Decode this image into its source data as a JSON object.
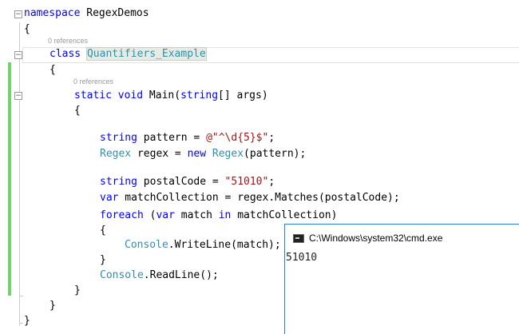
{
  "editor": {
    "refs_label": "0 references",
    "lines": [
      {
        "indent": 0,
        "tokens": [
          {
            "c": "kw",
            "text": "namespace"
          },
          {
            "c": "tx",
            "text": " RegexDemos"
          }
        ]
      },
      {
        "indent": 0,
        "tokens": [
          {
            "c": "tx",
            "text": "{"
          }
        ]
      },
      {
        "indent": 1,
        "tokens": [
          {
            "c": "kw",
            "text": "class"
          },
          {
            "c": "tx",
            "text": " "
          },
          {
            "c": "ty hl",
            "text": "Quantifiers_Example"
          }
        ]
      },
      {
        "indent": 1,
        "tokens": [
          {
            "c": "tx",
            "text": "{"
          }
        ]
      },
      {
        "indent": 2,
        "tokens": [
          {
            "c": "kw",
            "text": "static"
          },
          {
            "c": "tx",
            "text": " "
          },
          {
            "c": "kw",
            "text": "void"
          },
          {
            "c": "tx",
            "text": " Main("
          },
          {
            "c": "kw",
            "text": "string"
          },
          {
            "c": "tx",
            "text": "[] args)"
          }
        ]
      },
      {
        "indent": 2,
        "tokens": [
          {
            "c": "tx",
            "text": "{"
          }
        ]
      },
      {
        "indent": 3,
        "tokens": [
          {
            "c": "kw",
            "text": "string"
          },
          {
            "c": "tx",
            "text": " pattern = "
          },
          {
            "c": "st",
            "text": "@\"^\\d{5}$\""
          },
          {
            "c": "tx",
            "text": ";"
          }
        ]
      },
      {
        "indent": 3,
        "tokens": [
          {
            "c": "ty",
            "text": "Regex"
          },
          {
            "c": "tx",
            "text": " regex = "
          },
          {
            "c": "kw",
            "text": "new"
          },
          {
            "c": "tx",
            "text": " "
          },
          {
            "c": "ty",
            "text": "Regex"
          },
          {
            "c": "tx",
            "text": "(pattern);"
          }
        ]
      },
      {
        "indent": 3,
        "tokens": [
          {
            "c": "kw",
            "text": "string"
          },
          {
            "c": "tx",
            "text": " postalCode = "
          },
          {
            "c": "st",
            "text": "\"51010\""
          },
          {
            "c": "tx",
            "text": ";"
          }
        ]
      },
      {
        "indent": 3,
        "tokens": [
          {
            "c": "kw",
            "text": "var"
          },
          {
            "c": "tx",
            "text": " matchCollection = regex.Matches(postalCode);"
          }
        ]
      },
      {
        "indent": 3,
        "tokens": [
          {
            "c": "kw",
            "text": "foreach"
          },
          {
            "c": "tx",
            "text": " ("
          },
          {
            "c": "kw",
            "text": "var"
          },
          {
            "c": "tx",
            "text": " match "
          },
          {
            "c": "kw",
            "text": "in"
          },
          {
            "c": "tx",
            "text": " matchCollection)"
          }
        ]
      },
      {
        "indent": 3,
        "tokens": [
          {
            "c": "tx",
            "text": "{"
          }
        ]
      },
      {
        "indent": 4,
        "tokens": [
          {
            "c": "ty",
            "text": "Console"
          },
          {
            "c": "tx",
            "text": ".WriteLine(match);"
          }
        ]
      },
      {
        "indent": 3,
        "tokens": [
          {
            "c": "tx",
            "text": "}"
          }
        ]
      },
      {
        "indent": 3,
        "tokens": [
          {
            "c": "ty",
            "text": "Console"
          },
          {
            "c": "tx",
            "text": ".ReadLine();"
          }
        ]
      },
      {
        "indent": 2,
        "tokens": [
          {
            "c": "tx",
            "text": "}"
          }
        ]
      },
      {
        "indent": 1,
        "tokens": [
          {
            "c": "tx",
            "text": "}"
          }
        ]
      },
      {
        "indent": 0,
        "tokens": [
          {
            "c": "tx",
            "text": "}"
          }
        ]
      }
    ]
  },
  "console": {
    "title": "C:\\Windows\\system32\\cmd.exe",
    "output": "51010"
  }
}
